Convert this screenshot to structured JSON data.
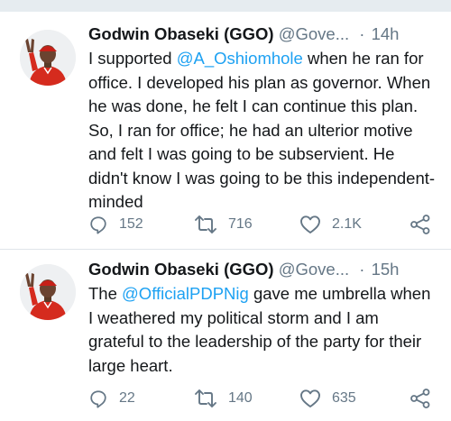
{
  "tweets": [
    {
      "author_name": "Godwin Obaseki (GGO)",
      "author_handle": "@Gove...",
      "separator": "·",
      "time": "14h",
      "body_before": "I supported ",
      "mention": "@A_Oshiomhole",
      "body_after": " when he ran for office. I developed his plan as governor. When he was done, he felt I can continue this plan. So, I ran for office; he had an ulterior motive and felt I was going to be subservient. He didn't know I was going to be this independent-minded",
      "reply_count": "152",
      "retweet_count": "716",
      "like_count": "2.1K"
    },
    {
      "author_name": "Godwin Obaseki (GGO)",
      "author_handle": "@Gove...",
      "separator": "·",
      "time": "15h",
      "body_before": "The ",
      "mention": "@OfficialPDPNig",
      "body_after": " gave me umbrella when I weathered my political storm and I am grateful to the leadership of the party for their large heart.",
      "reply_count": "22",
      "retweet_count": "140",
      "like_count": "635"
    }
  ],
  "icons": {
    "reply": "reply-icon",
    "retweet": "retweet-icon",
    "like": "heart-icon",
    "share": "share-icon"
  },
  "colors": {
    "mention": "#1da1f2",
    "secondary_text": "#657786",
    "primary_text": "#14171a",
    "background_strip": "#e6ecf0"
  }
}
